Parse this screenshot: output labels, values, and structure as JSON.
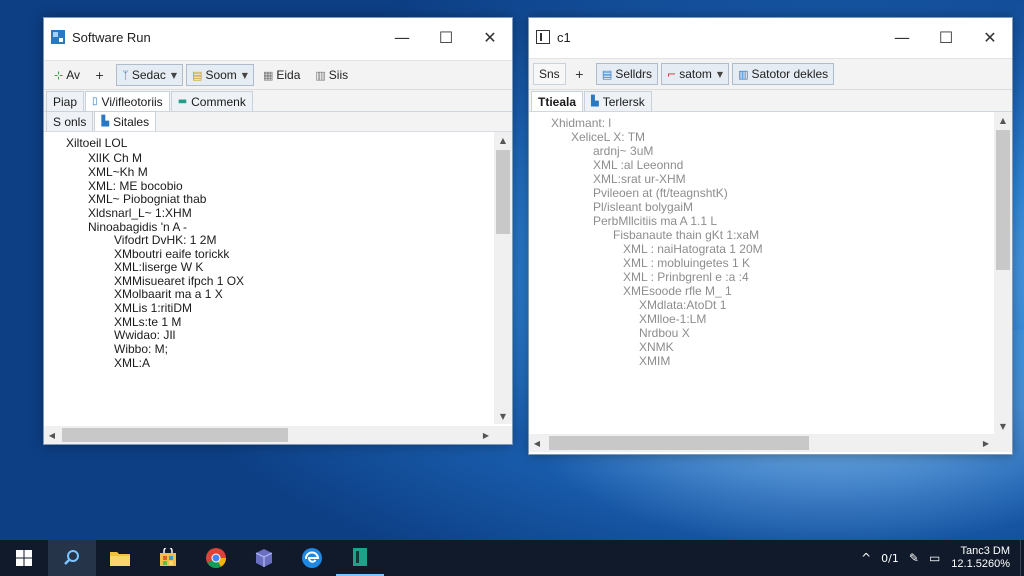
{
  "left_window": {
    "title": "Software Run",
    "caption": {
      "minimize": "—",
      "maximize": "☐",
      "close": "✕"
    },
    "toolbar": [
      {
        "icon": "⊹",
        "label": "Av",
        "boxed": false
      },
      {
        "icon": "+",
        "label": "",
        "boxed": false
      },
      {
        "icon": "ᛉ",
        "label": "Sedac",
        "boxed": true,
        "dropdown": "▼"
      },
      {
        "icon": "▤",
        "label": "Soom",
        "boxed": true,
        "dropdown": "▼"
      },
      {
        "icon": "▦",
        "label": "Eida",
        "boxed": false
      },
      {
        "icon": "▥",
        "label": "Siis",
        "boxed": false
      }
    ],
    "tabs": [
      {
        "label": "Piap",
        "icon": ""
      },
      {
        "label": "Vi/ifleotoriis",
        "icon": "▯"
      },
      {
        "label": "Commenk",
        "icon": "▬"
      }
    ],
    "subtabs": [
      {
        "label": "S onls",
        "icon": ""
      },
      {
        "label": "Sitales",
        "icon": "▙"
      }
    ],
    "tree": [
      "Xiltoeil LOL",
      "XlIK Ch M",
      "XML~Kh M",
      "XML: ME bocobio",
      "XML~ Piobogniat thab",
      "Xldsnarl_L~ 1:XHM",
      "Ninoabagidis 'n A -",
      "Vifodrt DvHK: 1 2M",
      "XMboutri eaife torickk",
      "XML:liserge W K",
      "XMMisuearet ifpch 1 OX",
      "XMolbaarit ma a 1 X",
      "XMLis 1:ritiDM",
      "XMLs:te 1 M",
      "Wwidao: JIl",
      "Wibbo: M;",
      "XML:A"
    ]
  },
  "right_window": {
    "title": "c1",
    "caption": {
      "minimize": "—",
      "maximize": "☐",
      "close": "✕"
    },
    "toolbar": [
      {
        "icon": "",
        "label": "Sns",
        "boxed": false
      },
      {
        "icon": "+",
        "label": "",
        "boxed": false
      },
      {
        "icon": "▤",
        "label": "Selldrs",
        "boxed": true
      },
      {
        "icon": "⌐",
        "label": "satom",
        "boxed": true,
        "dropdown": "▼"
      },
      {
        "icon": "▥",
        "label": "Satotor dekles",
        "boxed": true
      }
    ],
    "tabs": [
      {
        "label": "Ttieala",
        "icon": ""
      },
      {
        "label": "Terlersk",
        "icon": "▙"
      }
    ],
    "tree": [
      "Xhidmant: l",
      "XeliceL X: TM",
      "ardnj~ 3uM",
      "XML :al Leeonnd",
      "XML:srat ur-XHM",
      "Pvileoen at (ft/teagnshtK)",
      "Pl/isleant bolygaiM",
      "PerbMllcitiis ma A 1.1 L",
      "Fisbanaute thain gKt 1:xaM",
      "XML : naiHatograta 1 20M",
      "XML : mobluingetes 1 K",
      "XML : Prinbgrenl e :a :4",
      "XMEsoode rfle M_ 1",
      "XMdlata:AtoDt 1",
      "XMlloe-1:LM",
      "Nrdbou X",
      "XNMK",
      "XMIM"
    ]
  },
  "taskbar": {
    "items": [
      {
        "name": "windows-start-icon",
        "glyph": "⊞"
      },
      {
        "name": "search-icon",
        "glyph": "⚲"
      },
      {
        "name": "file-explorer-icon",
        "glyph": "▬"
      },
      {
        "name": "store-icon",
        "glyph": "▣"
      },
      {
        "name": "chrome-icon",
        "glyph": "◉"
      },
      {
        "name": "package-app-icon",
        "glyph": "◈"
      },
      {
        "name": "edge-icon",
        "glyph": "◐"
      },
      {
        "name": "terminal-app-icon",
        "glyph": "▮"
      }
    ],
    "tray": {
      "chevron": "^",
      "indicator": "0/1",
      "edit_glyph": "✎",
      "message_glyph": "▭",
      "time": "Tanc3 DM",
      "date": "12.1.5260%"
    }
  },
  "colors": {
    "accent": "#0078d7",
    "taskbar": "#101a2a",
    "window_border": "#7f9ab8"
  }
}
